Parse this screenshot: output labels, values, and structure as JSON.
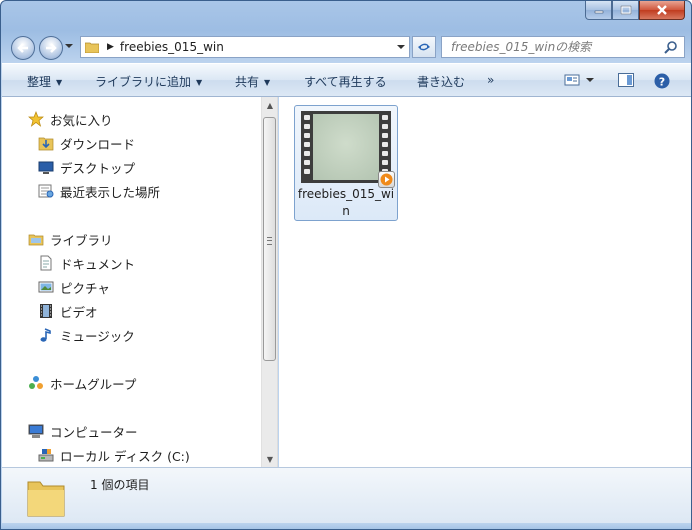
{
  "window": {
    "caption_buttons": [
      "minimize-icon",
      "maximize-icon",
      "close-icon"
    ]
  },
  "address": {
    "path": "freebies_015_win"
  },
  "search": {
    "placeholder": "freebies_015_winの検索"
  },
  "toolbar": {
    "organize": "整理",
    "add_to_library": "ライブラリに追加",
    "share": "共有",
    "play_all": "すべて再生する",
    "burn": "書き込む",
    "more": "»"
  },
  "sidebar": {
    "favorites": "お気に入り",
    "downloads": "ダウンロード",
    "desktop": "デスクトップ",
    "recent": "最近表示した場所",
    "libraries": "ライブラリ",
    "documents": "ドキュメント",
    "pictures": "ピクチャ",
    "videos": "ビデオ",
    "music": "ミュージック",
    "homegroup": "ホームグループ",
    "computer": "コンピューター",
    "local_disk": "ローカル ディスク (C:)"
  },
  "file": {
    "name": "freebies_015_win",
    "icon": "video-file-icon"
  },
  "details": {
    "count": "1 個の項目"
  },
  "colors": {
    "frame": "#a9c6e8",
    "toolbar_text": "#1e395b",
    "selection_border": "#7da2ce",
    "close_red": "#c03c1f"
  }
}
